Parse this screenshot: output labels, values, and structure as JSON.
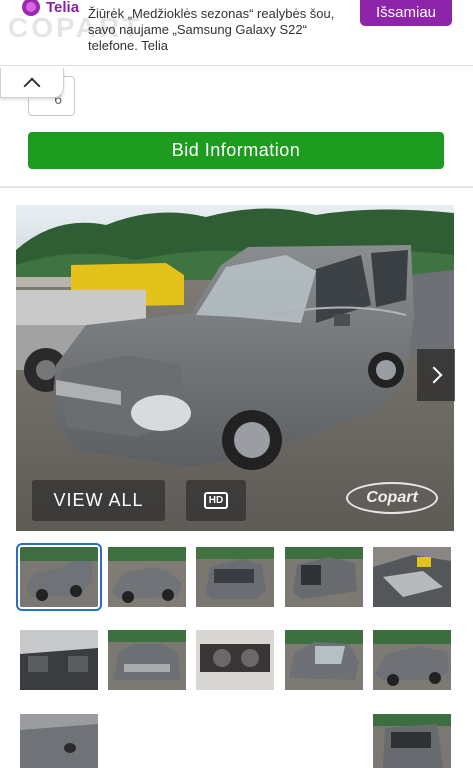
{
  "ad": {
    "brand": "Telia",
    "text": "Žiūrėk „Medžioklės sezonas“ realybės šou, savo naujame „Samsung Galaxy S22“ telefone. Telia",
    "cta": "Išsamiau",
    "watermark": "COPART"
  },
  "lot": {
    "partial_value": "6",
    "bid_button": "Bid Information"
  },
  "gallery": {
    "view_all": "VIEW ALL",
    "hd": "HD",
    "watermark": "Copart",
    "thumbnails": [
      "t1",
      "t2",
      "t3",
      "t4",
      "t5",
      "t6",
      "t7",
      "t8",
      "t9",
      "t10",
      "t11",
      "t12"
    ],
    "selected_index": 0
  },
  "colors": {
    "bid_green": "#1e9c1f",
    "telia_purple": "#8e24aa",
    "thumb_selected": "#2a6fc4"
  }
}
